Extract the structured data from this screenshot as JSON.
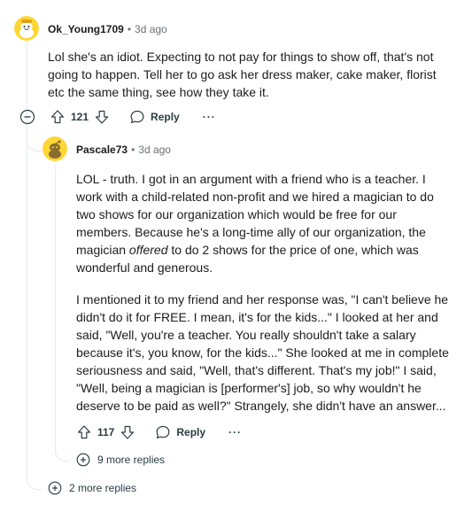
{
  "comments": [
    {
      "author": "Ok_Young1709",
      "separator": "•",
      "time": "3d ago",
      "paragraphs": [
        "Lol she's an idiot. Expecting to not pay for things to show off, that's not going to happen. Tell her to go ask her dress maker, cake maker, florist etc the same thing, see how they take it."
      ],
      "score": "121",
      "reply_label": "Reply",
      "more_label": "···"
    },
    {
      "author": "Pascale73",
      "separator": "•",
      "time": "3d ago",
      "paragraph1_before": "LOL - truth. I got in an argument with a friend who is a teacher. I work with a child-related non-profit and we hired a magician to do two shows for our organization which would be free for our members. Because he's a long-time ally of our organization, the magician ",
      "paragraph1_emphasis": "offered",
      "paragraph1_after": " to do 2 shows for the price of one, which was wonderful and generous.",
      "paragraph2": "I mentioned it to my friend and her response was, \"I can't believe he didn't do it for FREE. I mean, it's for the kids...\" I looked at her and said, \"Well, you're a teacher. You really shouldn't take a salary because it's, you know, for the kids...\" She looked at me in complete seriousness and said, \"Well, that's different. That's my job!\" I said, \"Well, being a magician is [performer's] job, so why wouldn't he deserve to be paid as well?\" Strangely, she didn't have an answer...",
      "score": "117",
      "reply_label": "Reply",
      "more_label": "···"
    }
  ],
  "more_replies_nested": "9 more replies",
  "more_replies_root": "2 more replies",
  "colors": {
    "text": "#1c1c1c",
    "meta": "#6b7175",
    "action": "#2a3c42",
    "thread_line": "#e5ebee",
    "avatar1_bg": "#ffd635",
    "avatar2_bg": "#ffd635"
  },
  "icons": {
    "avatar1": "snoo-avatar-icon",
    "avatar2": "snoo-avatar-icon",
    "collapse": "collapse-minus-icon",
    "upvote": "upvote-arrow-icon",
    "downvote": "downvote-arrow-icon",
    "reply": "speech-bubble-icon",
    "more": "ellipsis-icon",
    "expand": "plus-circle-icon"
  }
}
